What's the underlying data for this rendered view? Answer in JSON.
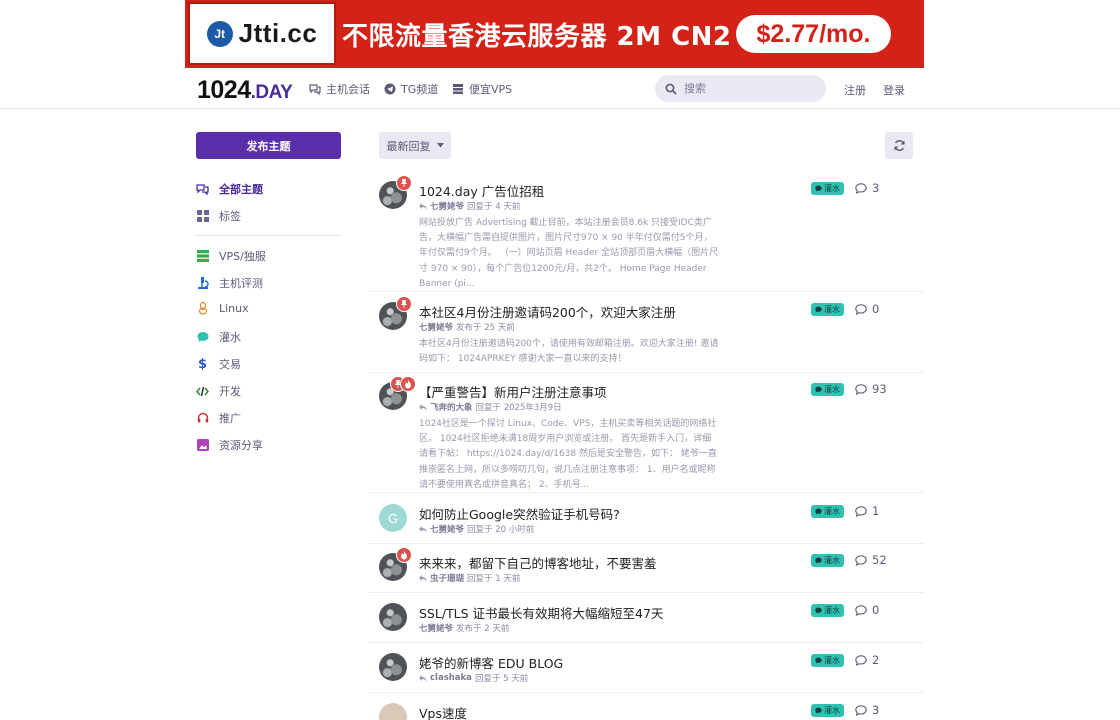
{
  "banner": {
    "logo_mark": "Jt",
    "logo_text": "Jtti.cc",
    "slogan": "不限流量香港云服务器 2M CN2",
    "price": "$2.77/mo."
  },
  "header": {
    "site_logo_main": "1024",
    "site_logo_suffix": ".DAY",
    "nav": [
      {
        "label": "主机会话",
        "icon": "chat-bubbles-icon"
      },
      {
        "label": "TG频道",
        "icon": "telegram-icon"
      },
      {
        "label": "便宜VPS",
        "icon": "server-icon"
      }
    ],
    "search_placeholder": "搜索",
    "register_label": "注册",
    "login_label": "登录"
  },
  "sidebar": {
    "new_topic_label": "发布主题",
    "items": [
      {
        "label": "全部主题",
        "icon": "comments-icon",
        "active": true
      },
      {
        "label": "标签",
        "icon": "tags-grid-icon"
      },
      {
        "label": "VPS/独服",
        "icon": "server-icon"
      },
      {
        "label": "主机评测",
        "icon": "microscope-icon"
      },
      {
        "label": "Linux",
        "icon": "linux-icon"
      },
      {
        "label": "灌水",
        "icon": "chat-icon"
      },
      {
        "label": "交易",
        "icon": "dollar-icon"
      },
      {
        "label": "开发",
        "icon": "code-icon"
      },
      {
        "label": "推广",
        "icon": "headset-icon"
      },
      {
        "label": "资源分享",
        "icon": "image-icon"
      }
    ]
  },
  "toolbar": {
    "sort_label": "最新回复"
  },
  "discussions": [
    {
      "title": "1024.day 广告位招租",
      "author": "七舅姥爷",
      "action": "回复于 4 天前",
      "reply_icon": true,
      "excerpt": "网站投放广告 Advertising 截止目前，本站注册会员8.6k 只接受IDC类广告，大横幅广告需自提供图片，图片尺寸970 × 90 半年付仅需付5个月，年付仅需付9个月。 （一）网站页眉 Header 全站顶部页眉大横幅（图片尺寸 970 × 90），每个广告位1200元/月，共2个。 Home Page Header Banner (pi...",
      "tag": "灌水",
      "replies": "3"
    },
    {
      "title": "本社区4月份注册邀请码200个，欢迎大家注册",
      "author": "七舅姥爷",
      "action": "发布于 25 天前",
      "reply_icon": false,
      "excerpt": "本社区4月份注册邀请码200个，请使用有效邮箱注册。欢迎大家注册! 邀请码如下： 1024APRKEY 感谢大家一直以来的支持！",
      "tag": "灌水",
      "replies": "0"
    },
    {
      "title": "【严重警告】新用户注册注意事项",
      "author": "飞奔的大象",
      "action": "回复于 2025年3月9日",
      "reply_icon": true,
      "excerpt": "1024社区是一个探讨 Linux、Code、VPS，主机买卖等相关话题的网络社区。 1024社区拒绝未满18周岁用户浏览或注册。 首先是新手入门，详细请看下帖： https://1024.day/d/1638 然后是安全警告，如下： 姥爷一直推崇匿名上网，所以多唠叨几句，说几点注册注意事项： 1、用户名或昵称请不要使用真名或拼音真名； 2、手机号...",
      "tag": "灌水",
      "replies": "93"
    },
    {
      "title": "如何防止Google突然验证手机号码?",
      "author": "七舅姥爷",
      "action": "回复于 20 小时前",
      "reply_icon": true,
      "excerpt": "",
      "tag": "灌水",
      "replies": "1",
      "avatar_letter": "G"
    },
    {
      "title": "来来来，都留下自己的博客地址，不要害羞",
      "author": "虫子珊瑚",
      "action": "回复于 1 天前",
      "reply_icon": true,
      "excerpt": "",
      "tag": "灌水",
      "replies": "52"
    },
    {
      "title": "SSL/TLS 证书最长有效期将大幅缩短至47天",
      "author": "七舅姥爷",
      "action": "发布于 2 天前",
      "reply_icon": false,
      "excerpt": "",
      "tag": "灌水",
      "replies": "0"
    },
    {
      "title": "姥爷的新博客 EDU BLOG",
      "author": "clashaka",
      "action": "回复于 5 天前",
      "reply_icon": true,
      "excerpt": "",
      "tag": "灌水",
      "replies": "2"
    },
    {
      "title": "Vps速度",
      "author": "",
      "action": "",
      "reply_icon": false,
      "excerpt": "",
      "tag": "灌水",
      "replies": "3"
    }
  ],
  "colors": {
    "brand": "#5b2fab",
    "banner_red": "#d32218",
    "tag_teal": "#2fc1b2",
    "pin_red": "#d9534f"
  }
}
